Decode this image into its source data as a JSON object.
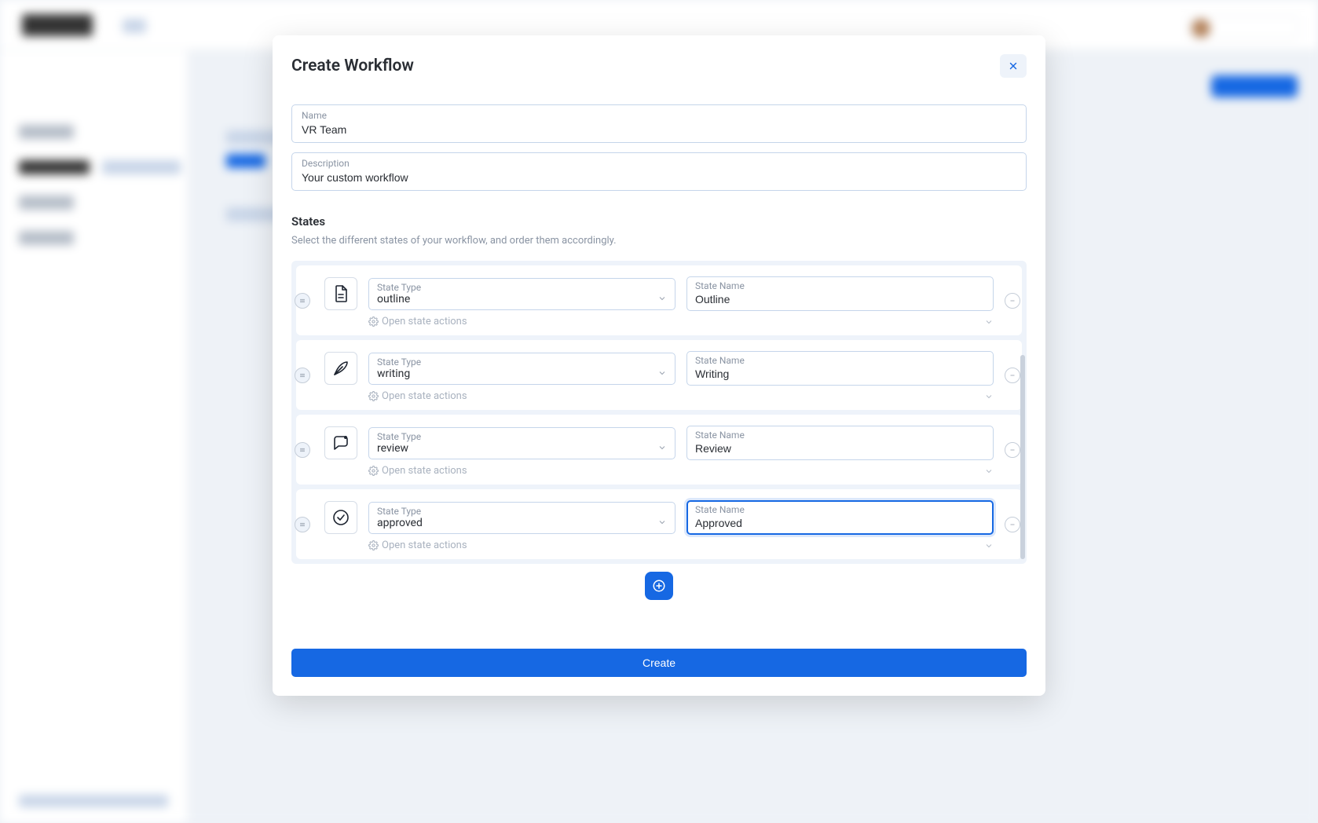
{
  "modal": {
    "title": "Create Workflow",
    "name_label": "Name",
    "name_value": "VR Team",
    "desc_label": "Description",
    "desc_value": "Your custom workflow",
    "states_heading": "States",
    "states_sub": "Select the different states of your workflow, and order them accordingly.",
    "type_label": "State Type",
    "name_field_label": "State Name",
    "open_actions_label": "Open state actions",
    "create_label": "Create",
    "states": [
      {
        "type": "outline",
        "name": "Outline",
        "icon": "document-icon",
        "focused": false
      },
      {
        "type": "writing",
        "name": "Writing",
        "icon": "feather-icon",
        "focused": false
      },
      {
        "type": "review",
        "name": "Review",
        "icon": "comment-icon",
        "focused": false
      },
      {
        "type": "approved",
        "name": "Approved",
        "icon": "check-circle-icon",
        "focused": true
      }
    ]
  }
}
